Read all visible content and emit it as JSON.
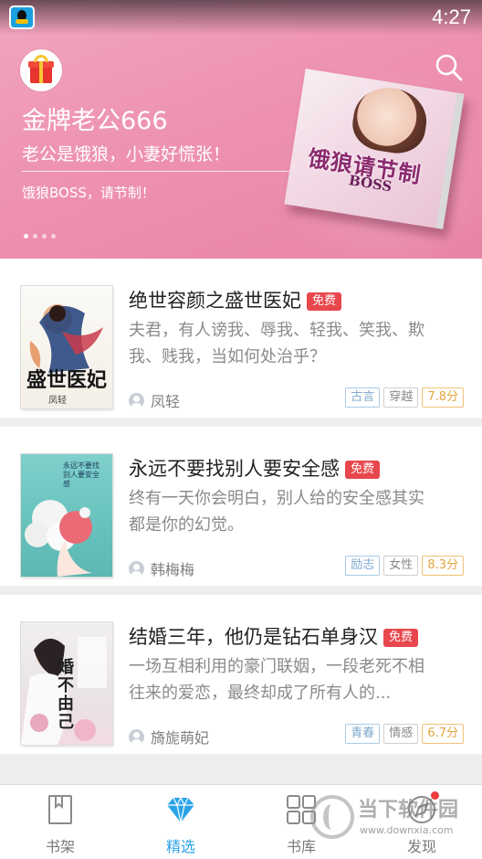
{
  "status_bar": {
    "time": "4:27"
  },
  "banner": {
    "title": "金牌老公666",
    "subtitle": "老公是饿狼，小妻好慌张！",
    "description": "饿狼BOSS，请节制！",
    "book_title": "饿狼请节制",
    "book_boss": "BOSS",
    "page_count": 4,
    "active_page": 1
  },
  "books": [
    {
      "title": "绝世容颜之盛世医妃",
      "badge": "免费",
      "description": "夫君，有人谤我、辱我、轻我、笑我、欺我、贱我，当如何处治乎？",
      "author": "凤轻",
      "tags": [
        "古言",
        "穿越"
      ],
      "score": "7.8分",
      "cover_text": "盛世医妃",
      "cover_author": "凤轻"
    },
    {
      "title": "永远不要找别人要安全感",
      "badge": "免费",
      "description": "终有一天你会明白，别人给的安全感其实都是你的幻觉。",
      "author": "韩梅梅",
      "tags": [
        "励志",
        "女性"
      ],
      "score": "8.3分",
      "cover_text": "永远不要找别人要安全感"
    },
    {
      "title": "结婚三年，他仍是钻石单身汉",
      "badge": "免费",
      "description": "一场互相利用的豪门联姻，一段老死不相往来的爱恋，最终却成了所有人的...",
      "author": "旖旎萌妃",
      "tags": [
        "青春",
        "情感"
      ],
      "score": "6.7分",
      "cover_text": "婚不由己"
    }
  ],
  "tabbar": {
    "items": [
      {
        "label": "书架",
        "icon": "bookmark-icon"
      },
      {
        "label": "精选",
        "icon": "diamond-icon"
      },
      {
        "label": "书库",
        "icon": "grid-icon"
      },
      {
        "label": "发现",
        "icon": "compass-icon"
      }
    ],
    "active": "精选"
  },
  "watermark": {
    "text": "当下软件园",
    "url": "www.downxia.com"
  },
  "colors": {
    "accent": "#2aa3e8",
    "banner": "#ee92b2",
    "free_badge": "#e8474d",
    "score": "#e4a43f"
  }
}
